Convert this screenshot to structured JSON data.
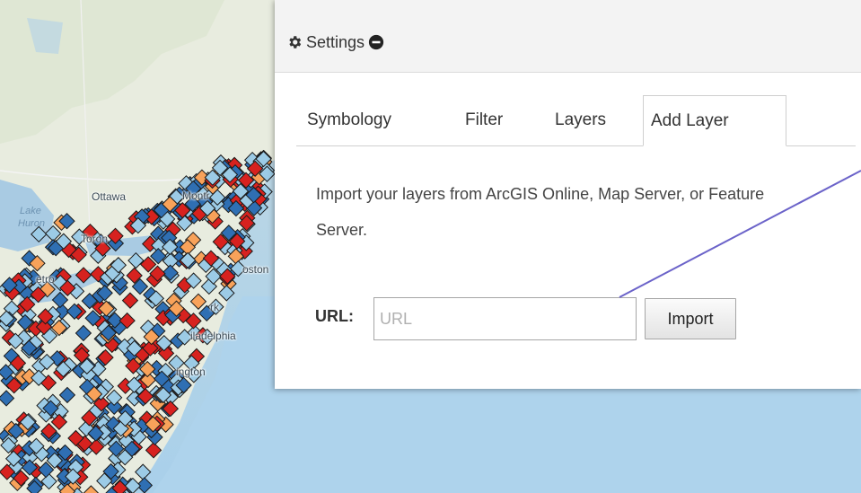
{
  "map": {
    "labels": {
      "ottawa": "Ottawa",
      "montreal": "Montr",
      "lake_huron_1": "Lake",
      "lake_huron_2": "Huron",
      "toronto": "Toron",
      "detroit": "etro",
      "boston": "oston",
      "ork": "rk",
      "philadelphia": "iladelphia",
      "washington": "ington"
    },
    "colors": {
      "dark_blue": "#2f6fb3",
      "light_blue": "#9ccbe6",
      "orange": "#f8a25a",
      "red": "#d7221f"
    }
  },
  "settings": {
    "title": "Settings",
    "icons": {
      "title_icon": "gear-icon",
      "collapse_icon": "minus-circle-icon"
    },
    "tabs": [
      {
        "label": "Symbology"
      },
      {
        "label": "Filter"
      },
      {
        "label": "Layers"
      },
      {
        "label": "Add Layer",
        "active": true
      }
    ],
    "description": "Import your layers from ArcGIS Online, Map Server, or Feature Server.",
    "url_label": "URL:",
    "url_placeholder": "URL",
    "url_value": "",
    "import_label": "Import"
  },
  "annotation": {
    "color": "#6b63c9"
  }
}
